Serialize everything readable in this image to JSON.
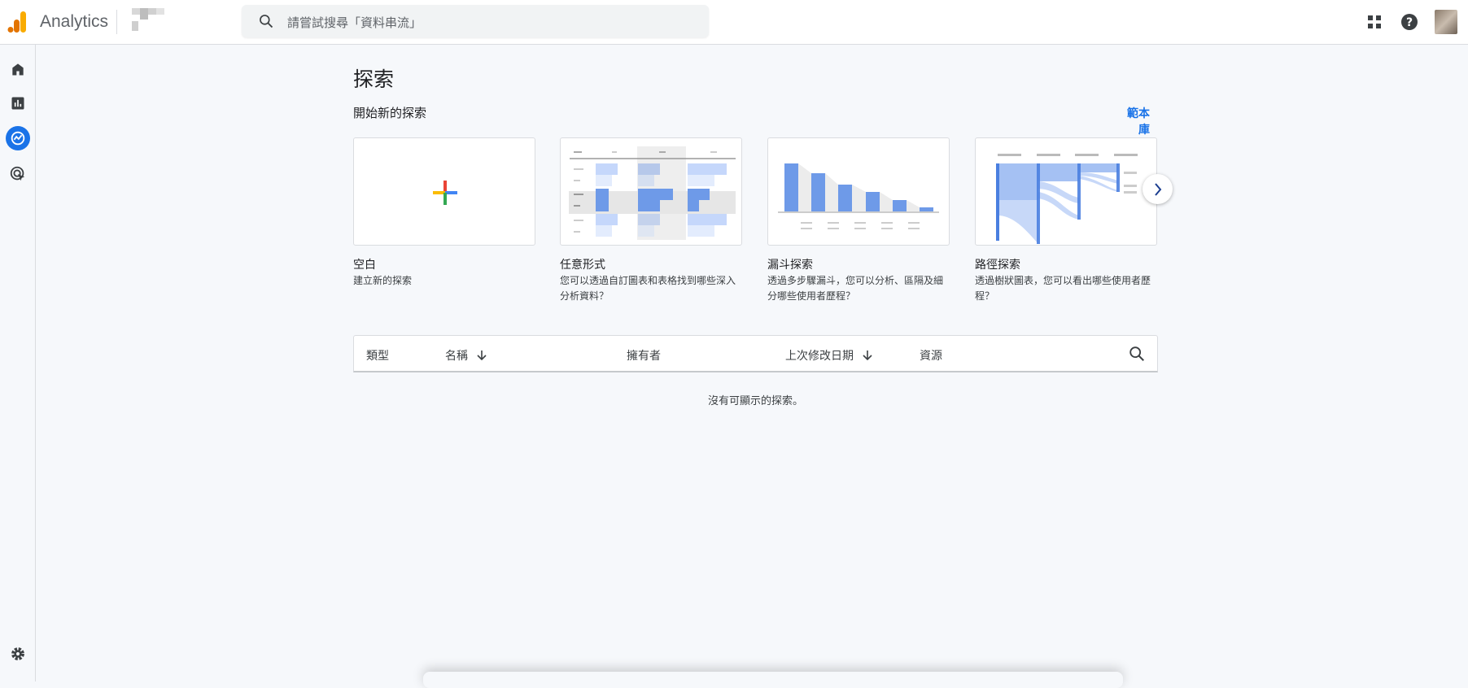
{
  "header": {
    "app_name": "Analytics",
    "search_placeholder": "請嘗試搜尋「資料串流」"
  },
  "sidebar": {
    "items": [
      {
        "icon": "home-icon"
      },
      {
        "icon": "reports-icon"
      },
      {
        "icon": "explore-icon",
        "active": true
      },
      {
        "icon": "advertising-icon"
      }
    ],
    "settings_icon": "gear-icon"
  },
  "main": {
    "title": "探索",
    "section_title": "開始新的探索",
    "template_library": "範本庫",
    "cards": [
      {
        "title": "空白",
        "desc": "建立新的探索"
      },
      {
        "title": "任意形式",
        "desc": "您可以透過自訂圖表和表格找到哪些深入分析資料？"
      },
      {
        "title": "漏斗探索",
        "desc": "透過多步驟漏斗，您可以分析、區隔及細分哪些使用者歷程？"
      },
      {
        "title": "路徑探索",
        "desc": "透過樹狀圖表，您可以看出哪些使用者歷程？"
      }
    ],
    "table": {
      "columns": [
        "類型",
        "名稱",
        "擁有者",
        "上次修改日期",
        "資源"
      ],
      "empty": "沒有可顯示的探索。"
    }
  },
  "colors": {
    "accent": "#1a73e8",
    "chart_blue": "#7ba3ec"
  }
}
